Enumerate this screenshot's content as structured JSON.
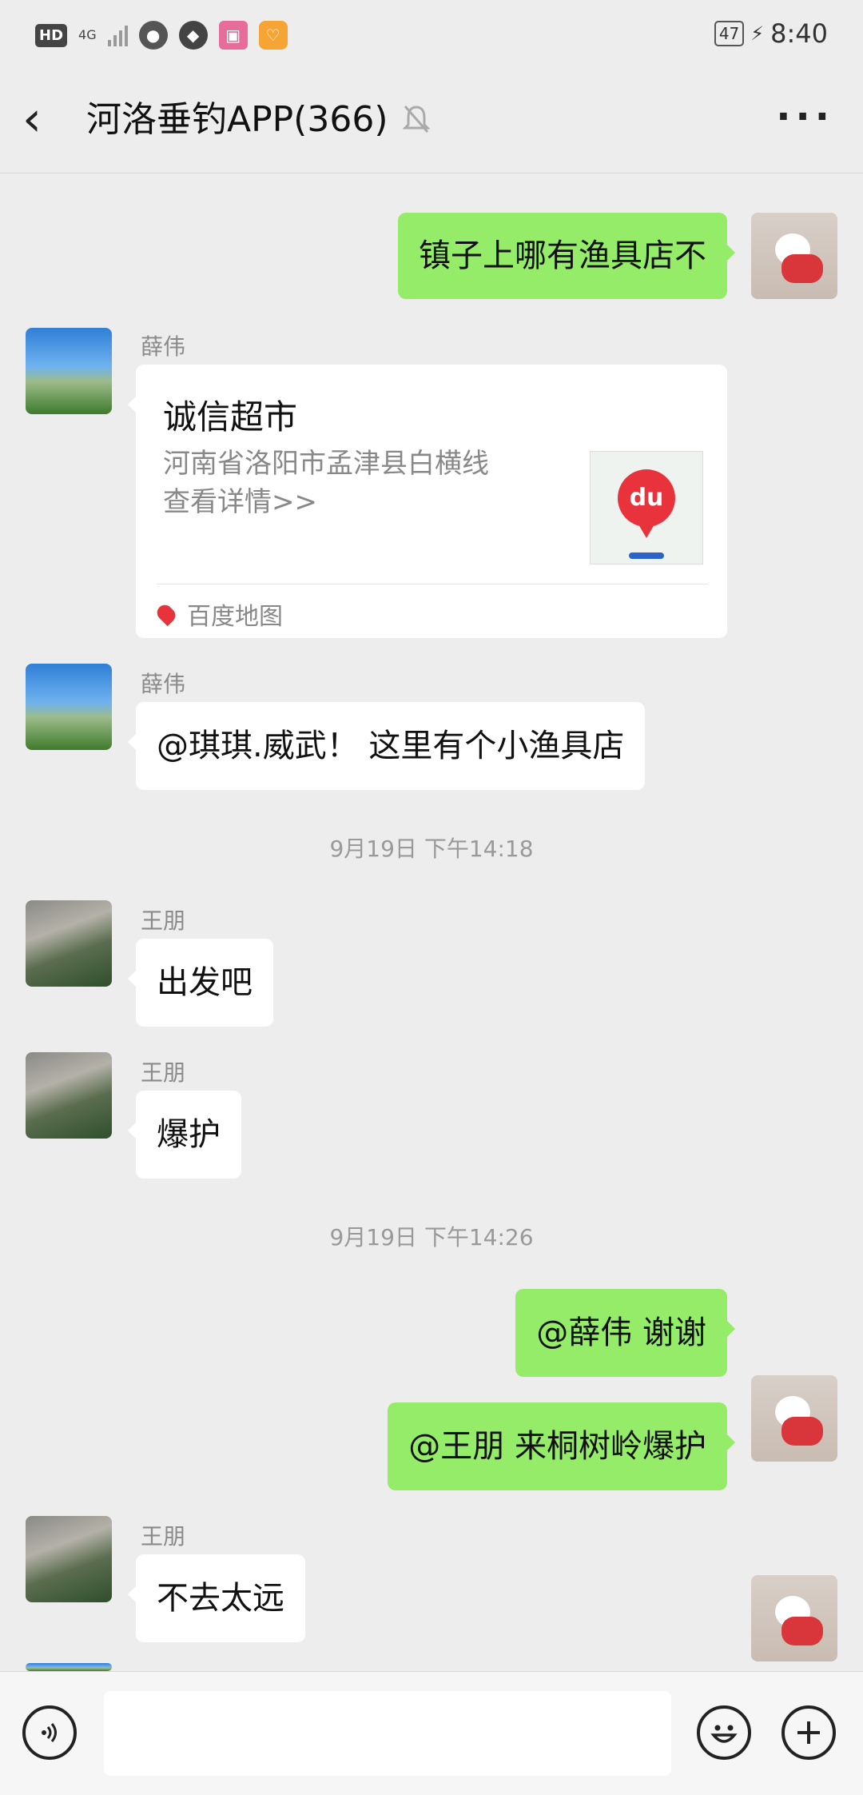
{
  "status_bar": {
    "hd": "HD",
    "network": "4G",
    "battery": "47",
    "time": "8:40"
  },
  "header": {
    "title": "河洛垂钓APP(366)",
    "back_icon": "chevron-left-icon",
    "mute_icon": "bell-off-icon",
    "more_icon": "more-dots-icon"
  },
  "messages": [
    {
      "type": "text",
      "from": "me",
      "text": "镇子上哪有渔具店不"
    },
    {
      "type": "location",
      "sender": "薛伟",
      "title": "诚信超市",
      "address": "河南省洛阳市孟津县白横线",
      "link": "查看详情>>",
      "source": "百度地图",
      "thumb_text": "du"
    },
    {
      "type": "text",
      "sender": "薛伟",
      "text": "@琪琪.威武！  这里有个小渔具店"
    },
    {
      "type": "time",
      "text": "9月19日 下午14:18"
    },
    {
      "type": "text",
      "sender": "王朋",
      "text": "出发吧"
    },
    {
      "type": "text",
      "sender": "王朋",
      "text": "爆护"
    },
    {
      "type": "time",
      "text": "9月19日 下午14:26"
    },
    {
      "type": "text",
      "from": "me",
      "text": "@薛伟  谢谢"
    },
    {
      "type": "text",
      "from": "me",
      "text": "@王朋  来桐树岭爆护"
    },
    {
      "type": "text",
      "sender": "王朋",
      "text": "不去太远"
    }
  ],
  "input_bar": {
    "voice_icon": "voice-icon",
    "emoji_icon": "emoji-icon",
    "plus_icon": "plus-icon"
  },
  "colors": {
    "background": "#ededed",
    "my_bubble": "#95ec69",
    "other_bubble": "#ffffff"
  }
}
